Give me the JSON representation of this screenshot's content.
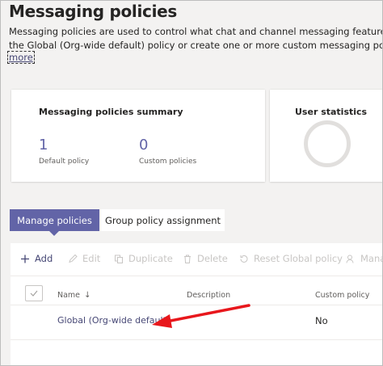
{
  "page": {
    "title": "Messaging policies",
    "description_line1": "Messaging policies are used to control what chat and channel messaging features are available",
    "description_line2": "the Global (Org-wide default) policy or create one or more custom messaging policies for peo",
    "more_link": "more"
  },
  "summary_card": {
    "title": "Messaging policies summary",
    "stats": [
      {
        "value": "1",
        "label": "Default policy"
      },
      {
        "value": "0",
        "label": "Custom policies"
      }
    ]
  },
  "user_stats_card": {
    "title": "User statistics"
  },
  "tabs": [
    {
      "label": "Manage policies",
      "active": true
    },
    {
      "label": "Group policy assignment",
      "active": false
    }
  ],
  "toolbar": {
    "add": "Add",
    "edit": "Edit",
    "duplicate": "Duplicate",
    "delete": "Delete",
    "reset": "Reset Global policy",
    "manage": "Mana"
  },
  "table": {
    "columns": {
      "name": "Name",
      "sort_indicator": "↓",
      "description": "Description",
      "custom": "Custom policy"
    },
    "rows": [
      {
        "name": "Global (Org-wide default)",
        "description": "",
        "custom": "No"
      }
    ]
  },
  "colors": {
    "accent": "#6264a7",
    "link": "#464775",
    "annotation_arrow": "#e8171c",
    "disabled_text": "#c8c6c4"
  }
}
